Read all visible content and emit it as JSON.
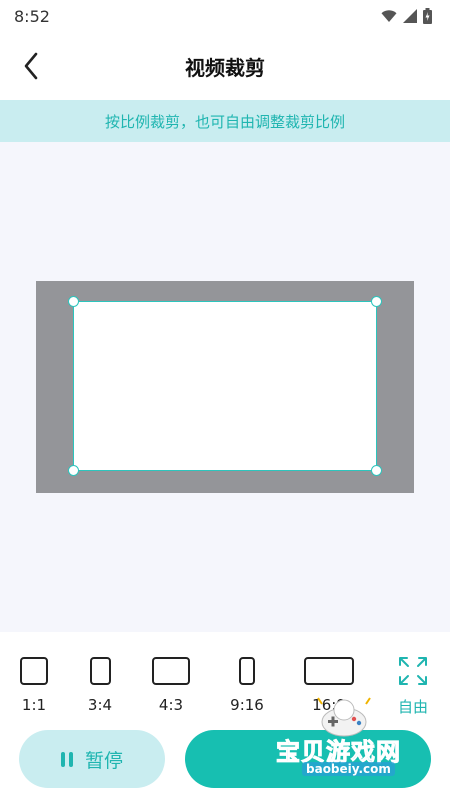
{
  "status_bar": {
    "time": "8:52",
    "icons": [
      "wifi-icon",
      "signal-icon",
      "battery-icon"
    ]
  },
  "header": {
    "back_icon": "chevron-left-icon",
    "title": "视频裁剪"
  },
  "banner": {
    "text": "按比例裁剪，也可自由调整裁剪比例"
  },
  "ratios": [
    {
      "label": "1:1",
      "icon": "ratio-1-1-icon"
    },
    {
      "label": "3:4",
      "icon": "ratio-3-4-icon"
    },
    {
      "label": "4:3",
      "icon": "ratio-4-3-icon"
    },
    {
      "label": "9:16",
      "icon": "ratio-9-16-icon"
    },
    {
      "label": "16:9",
      "icon": "ratio-16-9-icon"
    },
    {
      "label": "自由",
      "icon": "expand-arrows-icon"
    }
  ],
  "actions": {
    "pause_label": "暂停",
    "pause_icon": "pause-icon"
  },
  "watermark": {
    "title": "宝贝游戏网",
    "url": "baobeiy.com"
  },
  "colors": {
    "accent": "#1fb5b0",
    "accent_light": "#c9edf0",
    "confirm": "#17bfb1",
    "canvas_bg": "#f5f6fc",
    "video_gray": "#949599"
  }
}
